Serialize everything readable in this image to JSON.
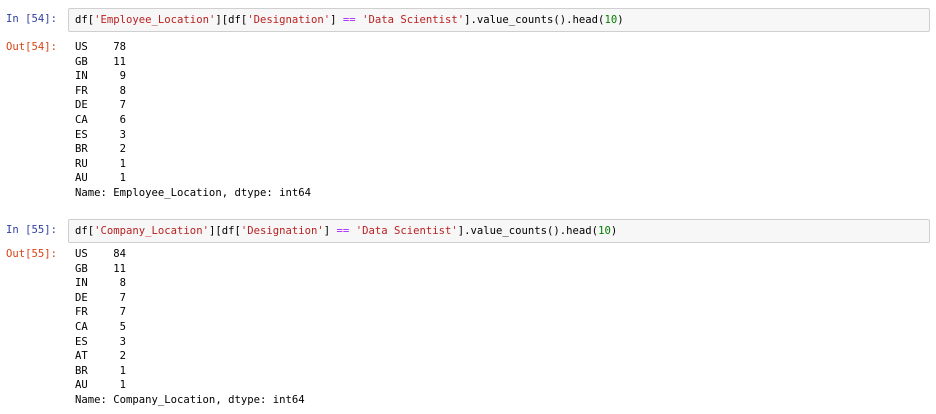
{
  "cells": [
    {
      "in_prompt": "In [54]:",
      "out_prompt": "Out[54]:",
      "code": [
        {
          "t": "df[",
          "c": "plain"
        },
        {
          "t": "'Employee_Location'",
          "c": "str"
        },
        {
          "t": "][df[",
          "c": "plain"
        },
        {
          "t": "'Designation'",
          "c": "str"
        },
        {
          "t": "] ",
          "c": "plain"
        },
        {
          "t": "==",
          "c": "op"
        },
        {
          "t": " ",
          "c": "plain"
        },
        {
          "t": "'Data Scientist'",
          "c": "str"
        },
        {
          "t": "].value_counts().head(",
          "c": "plain"
        },
        {
          "t": "10",
          "c": "num"
        },
        {
          "t": ")",
          "c": "plain"
        }
      ],
      "output_rows": [
        {
          "key": "US",
          "value": "78"
        },
        {
          "key": "GB",
          "value": "11"
        },
        {
          "key": "IN",
          "value": " 9"
        },
        {
          "key": "FR",
          "value": " 8"
        },
        {
          "key": "DE",
          "value": " 7"
        },
        {
          "key": "CA",
          "value": " 6"
        },
        {
          "key": "ES",
          "value": " 3"
        },
        {
          "key": "BR",
          "value": " 2"
        },
        {
          "key": "RU",
          "value": " 1"
        },
        {
          "key": "AU",
          "value": " 1"
        }
      ],
      "output_footer": "Name: Employee_Location, dtype: int64"
    },
    {
      "in_prompt": "In [55]:",
      "out_prompt": "Out[55]:",
      "code": [
        {
          "t": "df[",
          "c": "plain"
        },
        {
          "t": "'Company_Location'",
          "c": "str"
        },
        {
          "t": "][df[",
          "c": "plain"
        },
        {
          "t": "'Designation'",
          "c": "str"
        },
        {
          "t": "] ",
          "c": "plain"
        },
        {
          "t": "==",
          "c": "op"
        },
        {
          "t": " ",
          "c": "plain"
        },
        {
          "t": "'Data Scientist'",
          "c": "str"
        },
        {
          "t": "].value_counts().head(",
          "c": "plain"
        },
        {
          "t": "10",
          "c": "num"
        },
        {
          "t": ")",
          "c": "plain"
        }
      ],
      "output_rows": [
        {
          "key": "US",
          "value": "84"
        },
        {
          "key": "GB",
          "value": "11"
        },
        {
          "key": "IN",
          "value": " 8"
        },
        {
          "key": "DE",
          "value": " 7"
        },
        {
          "key": "FR",
          "value": " 7"
        },
        {
          "key": "CA",
          "value": " 5"
        },
        {
          "key": "ES",
          "value": " 3"
        },
        {
          "key": "AT",
          "value": " 2"
        },
        {
          "key": "BR",
          "value": " 1"
        },
        {
          "key": "AU",
          "value": " 1"
        }
      ],
      "output_footer": "Name: Company_Location, dtype: int64"
    }
  ],
  "colors": {
    "prompt_in": "#303f9f",
    "prompt_out": "#d84315",
    "string": "#ba2121",
    "operator": "#aa22ff",
    "number": "#008000",
    "input_bg": "#f7f7f7",
    "input_border": "#cfcfcf"
  }
}
